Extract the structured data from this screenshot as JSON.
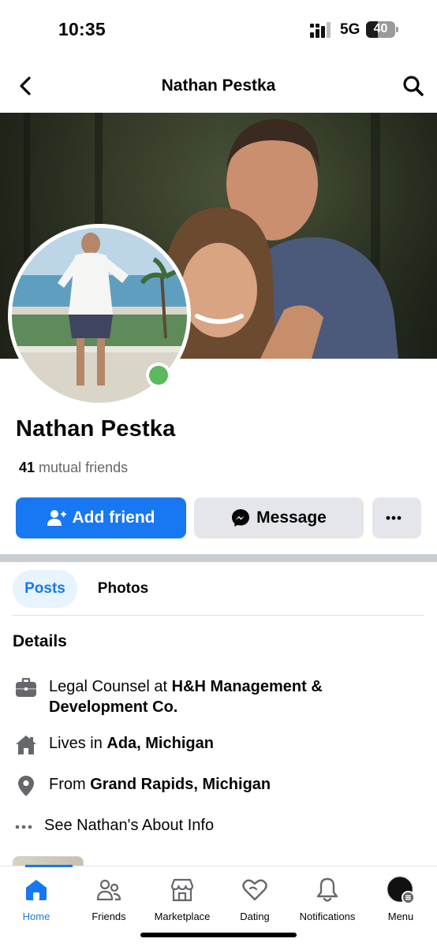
{
  "status_bar": {
    "time": "10:35",
    "network": "5G",
    "battery": "40",
    "battery_level": 0.4
  },
  "header": {
    "title": "Nathan Pestka"
  },
  "profile": {
    "name": "Nathan Pestka",
    "mutual_count": "41",
    "mutual_label": "mutual friends",
    "online": true
  },
  "actions": {
    "add_friend": "Add friend",
    "message": "Message"
  },
  "tabs": [
    {
      "label": "Posts",
      "active": true
    },
    {
      "label": "Photos",
      "active": false
    }
  ],
  "details": {
    "title": "Details",
    "work_prefix": "Legal Counsel at ",
    "work_place": "H&H Management & Development Co.",
    "lives_prefix": "Lives in ",
    "lives_place": "Ada, Michigan",
    "from_prefix": "From ",
    "from_place": "Grand Rapids, Michigan",
    "about_link": "See Nathan's About Info"
  },
  "bottom_nav": [
    {
      "label": "Home",
      "icon": "home-icon",
      "active": true
    },
    {
      "label": "Friends",
      "icon": "friends-icon",
      "active": false
    },
    {
      "label": "Marketplace",
      "icon": "marketplace-icon",
      "active": false
    },
    {
      "label": "Dating",
      "icon": "dating-icon",
      "active": false
    },
    {
      "label": "Notifications",
      "icon": "bell-icon",
      "active": false
    },
    {
      "label": "Menu",
      "icon": "menu-avatar-icon",
      "active": false
    }
  ],
  "colors": {
    "accent": "#1877f2",
    "online": "#5cb85c",
    "button_gray": "#e4e6eb"
  }
}
